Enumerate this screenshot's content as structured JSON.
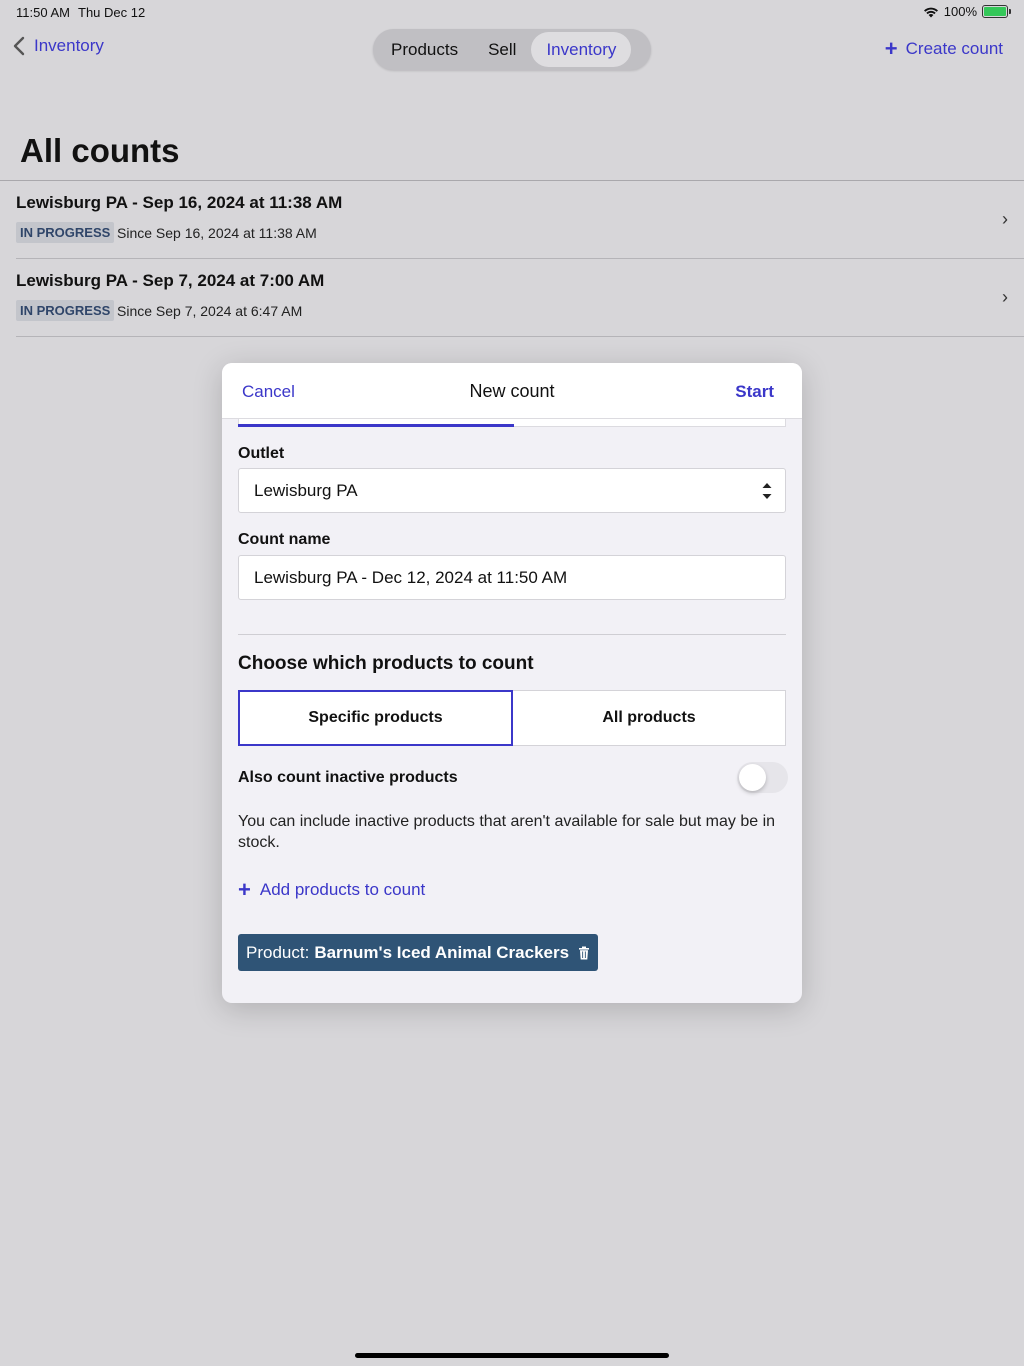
{
  "status_bar": {
    "time": "11:50 AM",
    "date": "Thu Dec 12",
    "battery": "100%"
  },
  "nav": {
    "back_label": "Inventory",
    "tabs": [
      {
        "label": "Products",
        "active": false
      },
      {
        "label": "Sell",
        "active": false
      },
      {
        "label": "Inventory",
        "active": true
      }
    ],
    "create_count_label": "Create count"
  },
  "page": {
    "title": "All counts",
    "counts": [
      {
        "title": "Lewisburg PA - Sep 16, 2024 at 11:38 AM",
        "status": "IN PROGRESS",
        "since": "Since Sep 16, 2024 at 11:38 AM"
      },
      {
        "title": "Lewisburg PA - Sep 7, 2024 at 7:00 AM",
        "status": "IN PROGRESS",
        "since": "Since Sep 7, 2024 at 6:47 AM"
      }
    ]
  },
  "modal": {
    "cancel_label": "Cancel",
    "title": "New count",
    "start_label": "Start",
    "outlet_label": "Outlet",
    "outlet_value": "Lewisburg PA",
    "count_name_label": "Count name",
    "count_name_value": "Lewisburg PA - Dec 12, 2024 at 11:50 AM",
    "choose_title": "Choose which products to count",
    "choice_specific": "Specific products",
    "choice_all": "All products",
    "selected_choice": "Specific products",
    "inactive_label": "Also count inactive products",
    "inactive_toggle_on": false,
    "help_text": "You can include inactive products that aren't available for sale but may be in stock.",
    "add_products_label": "Add products to count",
    "chip_prefix": "Product:",
    "chip_value": "Barnum's Iced Animal Crackers"
  },
  "colors": {
    "accent": "#3b37c9",
    "chip_bg": "#2f5476",
    "badge_text": "#2f4569"
  }
}
